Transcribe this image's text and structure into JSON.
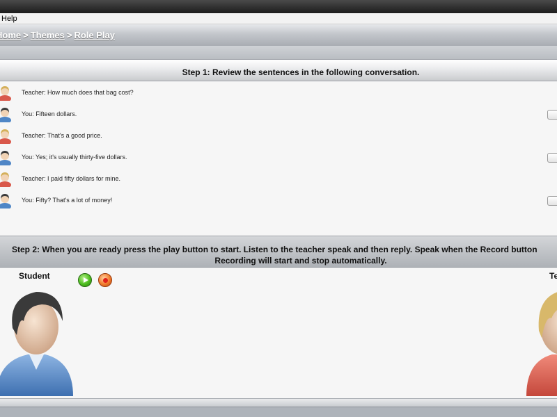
{
  "menu": {
    "help_label": "Help"
  },
  "breadcrumb": [
    {
      "label": "Home"
    },
    {
      "label": "Themes"
    },
    {
      "label": "Role Play"
    }
  ],
  "breadcrumb_separator": ">",
  "step1": {
    "title": "Step 1: Review the sentences in the following conversation."
  },
  "conversation": [
    {
      "speaker": "teacher",
      "text": "Teacher: How much does that bag cost?",
      "has_checkbox": false
    },
    {
      "speaker": "student",
      "text": "You: Fifteen dollars.",
      "has_checkbox": true
    },
    {
      "speaker": "teacher",
      "text": "Teacher: That's a good price.",
      "has_checkbox": false
    },
    {
      "speaker": "student",
      "text": "You: Yes; it's usually thirty-five dollars.",
      "has_checkbox": true
    },
    {
      "speaker": "teacher",
      "text": "Teacher: I paid fifty dollars for mine.",
      "has_checkbox": false
    },
    {
      "speaker": "student",
      "text": "You: Fifty? That's a lot of money!",
      "has_checkbox": true
    }
  ],
  "step2": {
    "line1": "Step 2: When you are ready press the play button to start. Listen to the teacher speak and then reply. Speak when the Record button",
    "line2": "Recording will start and stop automatically."
  },
  "stage": {
    "student_label": "Student",
    "teacher_label": "Te",
    "play_icon": "play-icon",
    "record_icon": "record-icon"
  },
  "colors": {
    "student_shirt": "#4f86c6",
    "teacher_shirt": "#d9584a",
    "student_hair": "#3a3a3a",
    "teacher_hair": "#d4b05a",
    "play_green": "#4cbc1e",
    "record_orange": "#f07a2a"
  }
}
